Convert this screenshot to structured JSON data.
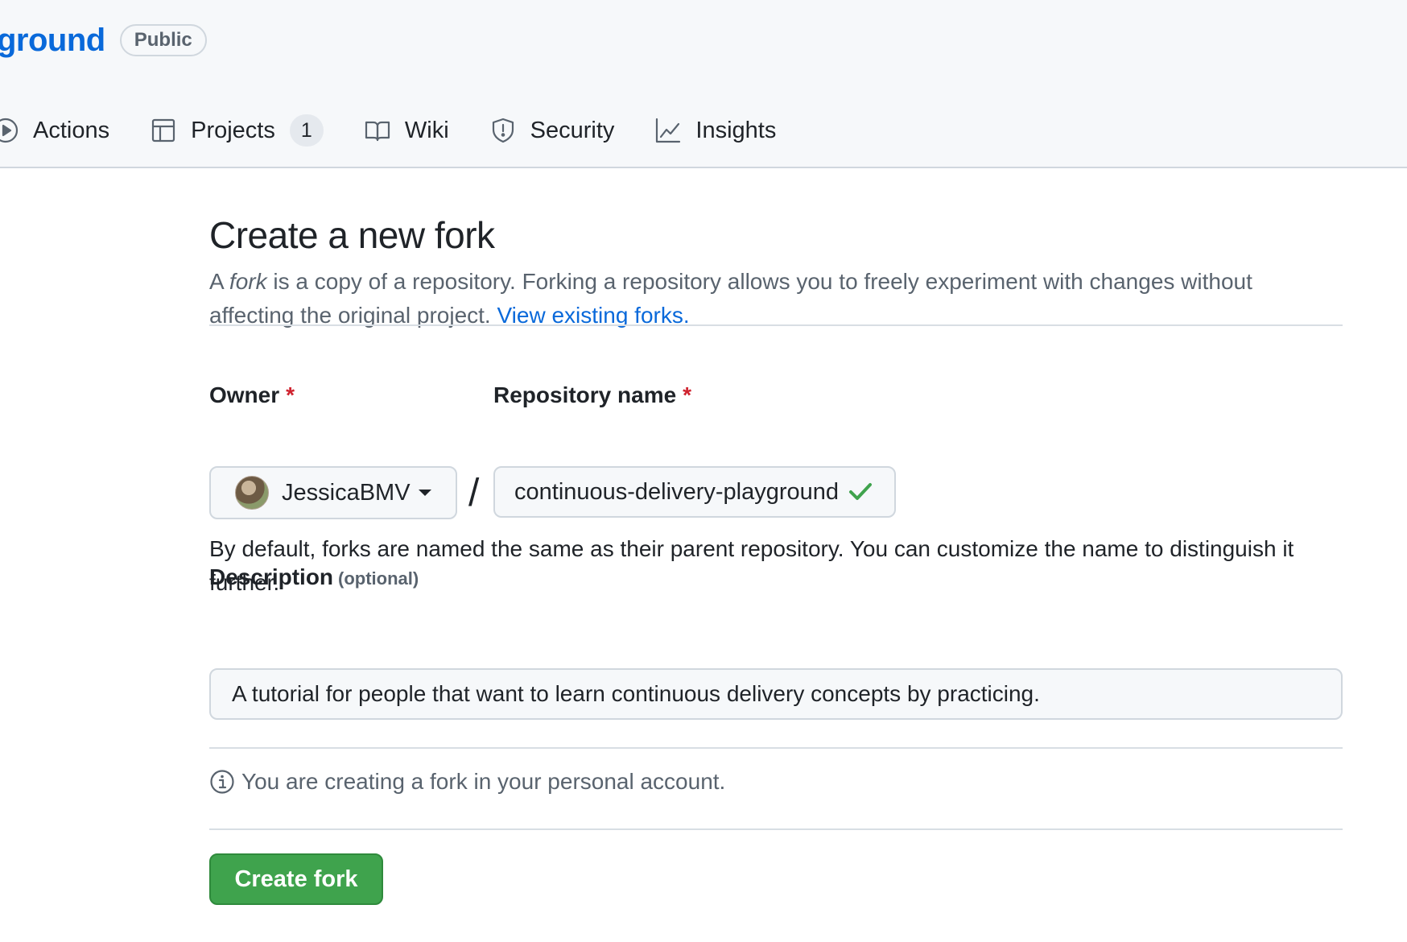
{
  "header": {
    "repo_name": "ground",
    "visibility_badge": "Public",
    "tabs": [
      {
        "label": "Actions",
        "icon": "play-circle-icon"
      },
      {
        "label": "Projects",
        "icon": "table-icon",
        "count": "1"
      },
      {
        "label": "Wiki",
        "icon": "book-icon"
      },
      {
        "label": "Security",
        "icon": "shield-icon"
      },
      {
        "label": "Insights",
        "icon": "graph-icon"
      }
    ]
  },
  "page": {
    "title": "Create a new fork",
    "intro_prefix": "A ",
    "intro_em": "fork",
    "intro_rest": " is a copy of a repository. Forking a repository allows you to freely experiment with changes without affecting the original project. ",
    "intro_link": "View existing forks."
  },
  "form": {
    "owner_label": "Owner",
    "required_mark": "*",
    "owner_value": "JessicaBMV",
    "separator": "/",
    "repo_name_label": "Repository name",
    "repo_name_value": "continuous-delivery-playground",
    "name_hint": "By default, forks are named the same as their parent repository. You can customize the name to distinguish it further.",
    "description_label": "Description",
    "description_optional": "(optional)",
    "description_value": "A tutorial for people that want to learn continuous delivery concepts by practicing.",
    "info_text": "You are creating a fork in your personal account.",
    "submit_label": "Create fork"
  },
  "colors": {
    "accent": "#0969da",
    "required": "#cf222e",
    "primary_button": "#3fa34d",
    "valid_check": "#3fa34d"
  }
}
